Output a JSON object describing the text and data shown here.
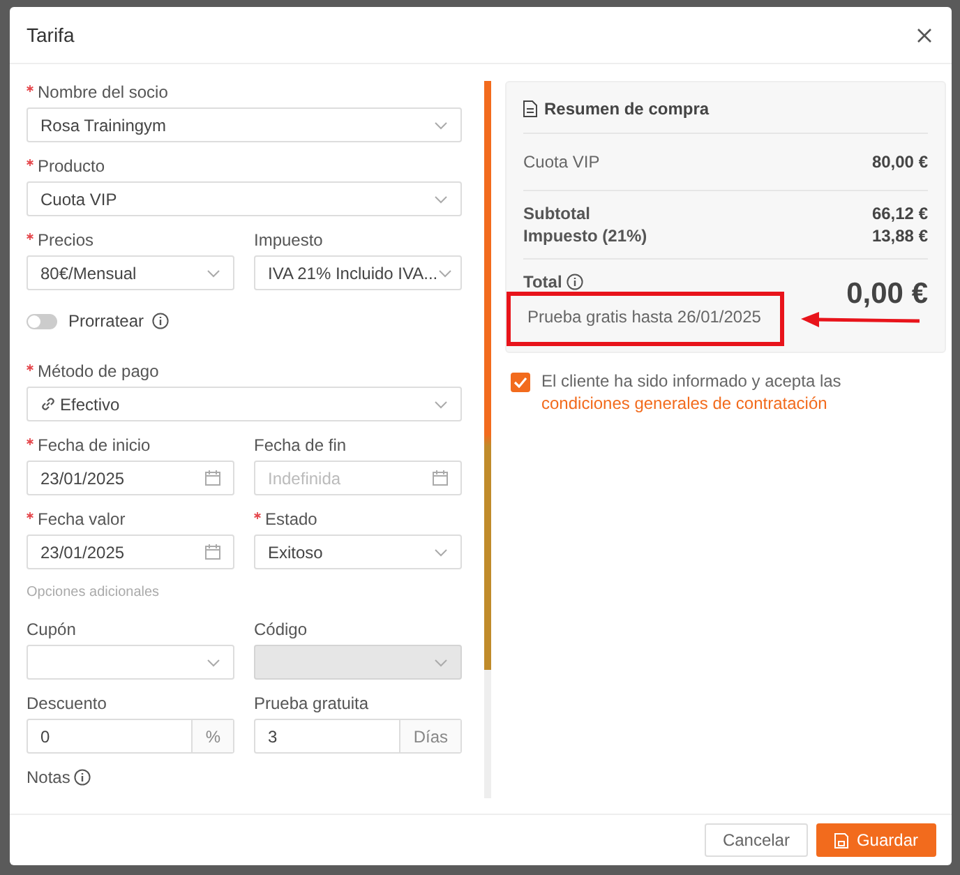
{
  "modal": {
    "title": "Tarifa"
  },
  "form": [
    [
      {
        "kind": "select",
        "label": "Nombre del socio",
        "required": true,
        "value": "Rosa Trainingym"
      }
    ],
    [
      {
        "kind": "select",
        "label": "Producto",
        "required": true,
        "value": "Cuota VIP"
      }
    ],
    [
      {
        "kind": "select",
        "label": "Precios",
        "required": true,
        "value": "80€/Mensual"
      },
      {
        "kind": "select",
        "label": "Impuesto",
        "required": false,
        "value": "IVA 21% Incluido IVA..."
      }
    ],
    [
      {
        "kind": "toggle",
        "label": "Prorratear",
        "on": false,
        "info": true
      }
    ],
    [
      {
        "kind": "payment",
        "label": "Método de pago",
        "required": true,
        "value": "Efectivo"
      }
    ],
    [
      {
        "kind": "date",
        "label": "Fecha de inicio",
        "required": true,
        "value": "23/01/2025"
      },
      {
        "kind": "date",
        "label": "Fecha de fin",
        "required": false,
        "placeholder": "Indefinida"
      }
    ],
    [
      {
        "kind": "date",
        "label": "Fecha valor",
        "required": true,
        "value": "23/01/2025"
      },
      {
        "kind": "select",
        "label": "Estado",
        "required": true,
        "value": "Exitoso"
      }
    ],
    [
      {
        "kind": "section",
        "label": "Opciones adicionales"
      }
    ],
    [
      {
        "kind": "select",
        "label": "Cupón",
        "required": false,
        "disabled": false
      },
      {
        "kind": "select",
        "label": "Código",
        "required": false,
        "disabled": true
      }
    ],
    [
      {
        "kind": "suffix",
        "label": "Descuento",
        "required": false,
        "value": "0",
        "suffix": "%"
      },
      {
        "kind": "suffix",
        "label": "Prueba gratuita",
        "required": false,
        "value": "3",
        "suffix": "Días"
      }
    ],
    [
      {
        "kind": "label",
        "label": "Notas",
        "info": true
      }
    ]
  ],
  "summary": {
    "title": "Resumen de compra",
    "items": [
      {
        "label": "Cuota VIP",
        "amount": "80,00 €"
      }
    ],
    "subtotals": [
      {
        "label": "Subtotal",
        "amount": "66,12 €"
      },
      {
        "label": "Impuesto (21%)",
        "amount": "13,88 €"
      }
    ],
    "total": {
      "label": "Total",
      "amount": "0,00 €"
    },
    "note": {
      "text": "Prueba gratis hasta 26/01/2025",
      "highlighted": true
    }
  },
  "consent": {
    "checked": true,
    "text": "El cliente ha sido informado y acepta las ",
    "link": "condiciones generales de contratación"
  },
  "buttons": [
    {
      "label": "Cancelar",
      "kind": "secondary"
    },
    {
      "label": "Guardar",
      "kind": "primary"
    }
  ]
}
